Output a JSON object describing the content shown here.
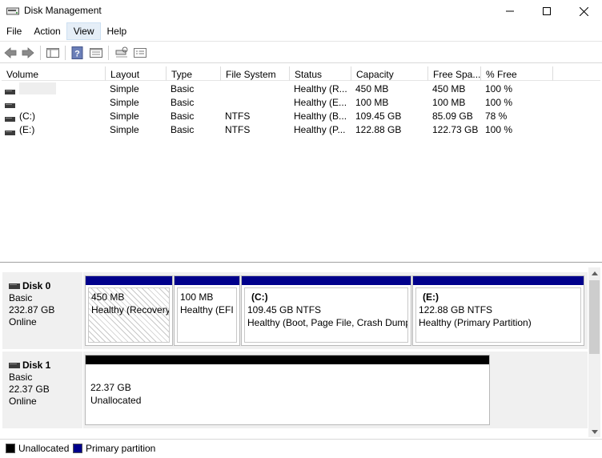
{
  "window": {
    "title": "Disk Management"
  },
  "menu": [
    "File",
    "Action",
    "View",
    "Help"
  ],
  "toolbar_icons": [
    "back-arrow-icon",
    "forward-arrow-icon",
    "show-hide-console-tree-icon",
    "help-icon",
    "properties-icon",
    "rescan-disks-icon",
    "disk-list-icon"
  ],
  "volume_list": {
    "columns": [
      "Volume",
      "Layout",
      "Type",
      "File System",
      "Status",
      "Capacity",
      "Free Spa...",
      "% Free"
    ],
    "rows": [
      {
        "volume": "",
        "layout": "Simple",
        "type": "Basic",
        "fs": "",
        "status": "Healthy (R...",
        "capacity": "450 MB",
        "free": "450 MB",
        "pct": "100 %"
      },
      {
        "volume": "",
        "layout": "Simple",
        "type": "Basic",
        "fs": "",
        "status": "Healthy (E...",
        "capacity": "100 MB",
        "free": "100 MB",
        "pct": "100 %"
      },
      {
        "volume": "(C:)",
        "layout": "Simple",
        "type": "Basic",
        "fs": "NTFS",
        "status": "Healthy (B...",
        "capacity": "109.45 GB",
        "free": "85.09 GB",
        "pct": "78 %"
      },
      {
        "volume": "(E:)",
        "layout": "Simple",
        "type": "Basic",
        "fs": "NTFS",
        "status": "Healthy (P...",
        "capacity": "122.88 GB",
        "free": "122.73 GB",
        "pct": "100 %"
      }
    ]
  },
  "disks": [
    {
      "name": "Disk 0",
      "type": "Basic",
      "size": "232.87 GB",
      "state": "Online",
      "partitions": [
        {
          "label": "",
          "size": "450 MB",
          "status": "Healthy (Recovery"
        },
        {
          "label": "",
          "size": "100 MB",
          "status": "Healthy (EFI S"
        },
        {
          "label": "(C:)",
          "size": "109.45 GB NTFS",
          "status": "Healthy (Boot, Page File, Crash Dump"
        },
        {
          "label": "(E:)",
          "size": "122.88 GB NTFS",
          "status": "Healthy (Primary Partition)"
        }
      ]
    },
    {
      "name": "Disk 1",
      "type": "Basic",
      "size": "22.37 GB",
      "state": "Online",
      "partitions": [
        {
          "label": "",
          "size": "22.37 GB",
          "status": "Unallocated"
        }
      ]
    }
  ],
  "legend": [
    {
      "label": "Unallocated",
      "color": "#000000"
    },
    {
      "label": "Primary partition",
      "color": "#00008b"
    }
  ],
  "colors": {
    "primary_partition": "#00008b",
    "unallocated": "#000000"
  }
}
